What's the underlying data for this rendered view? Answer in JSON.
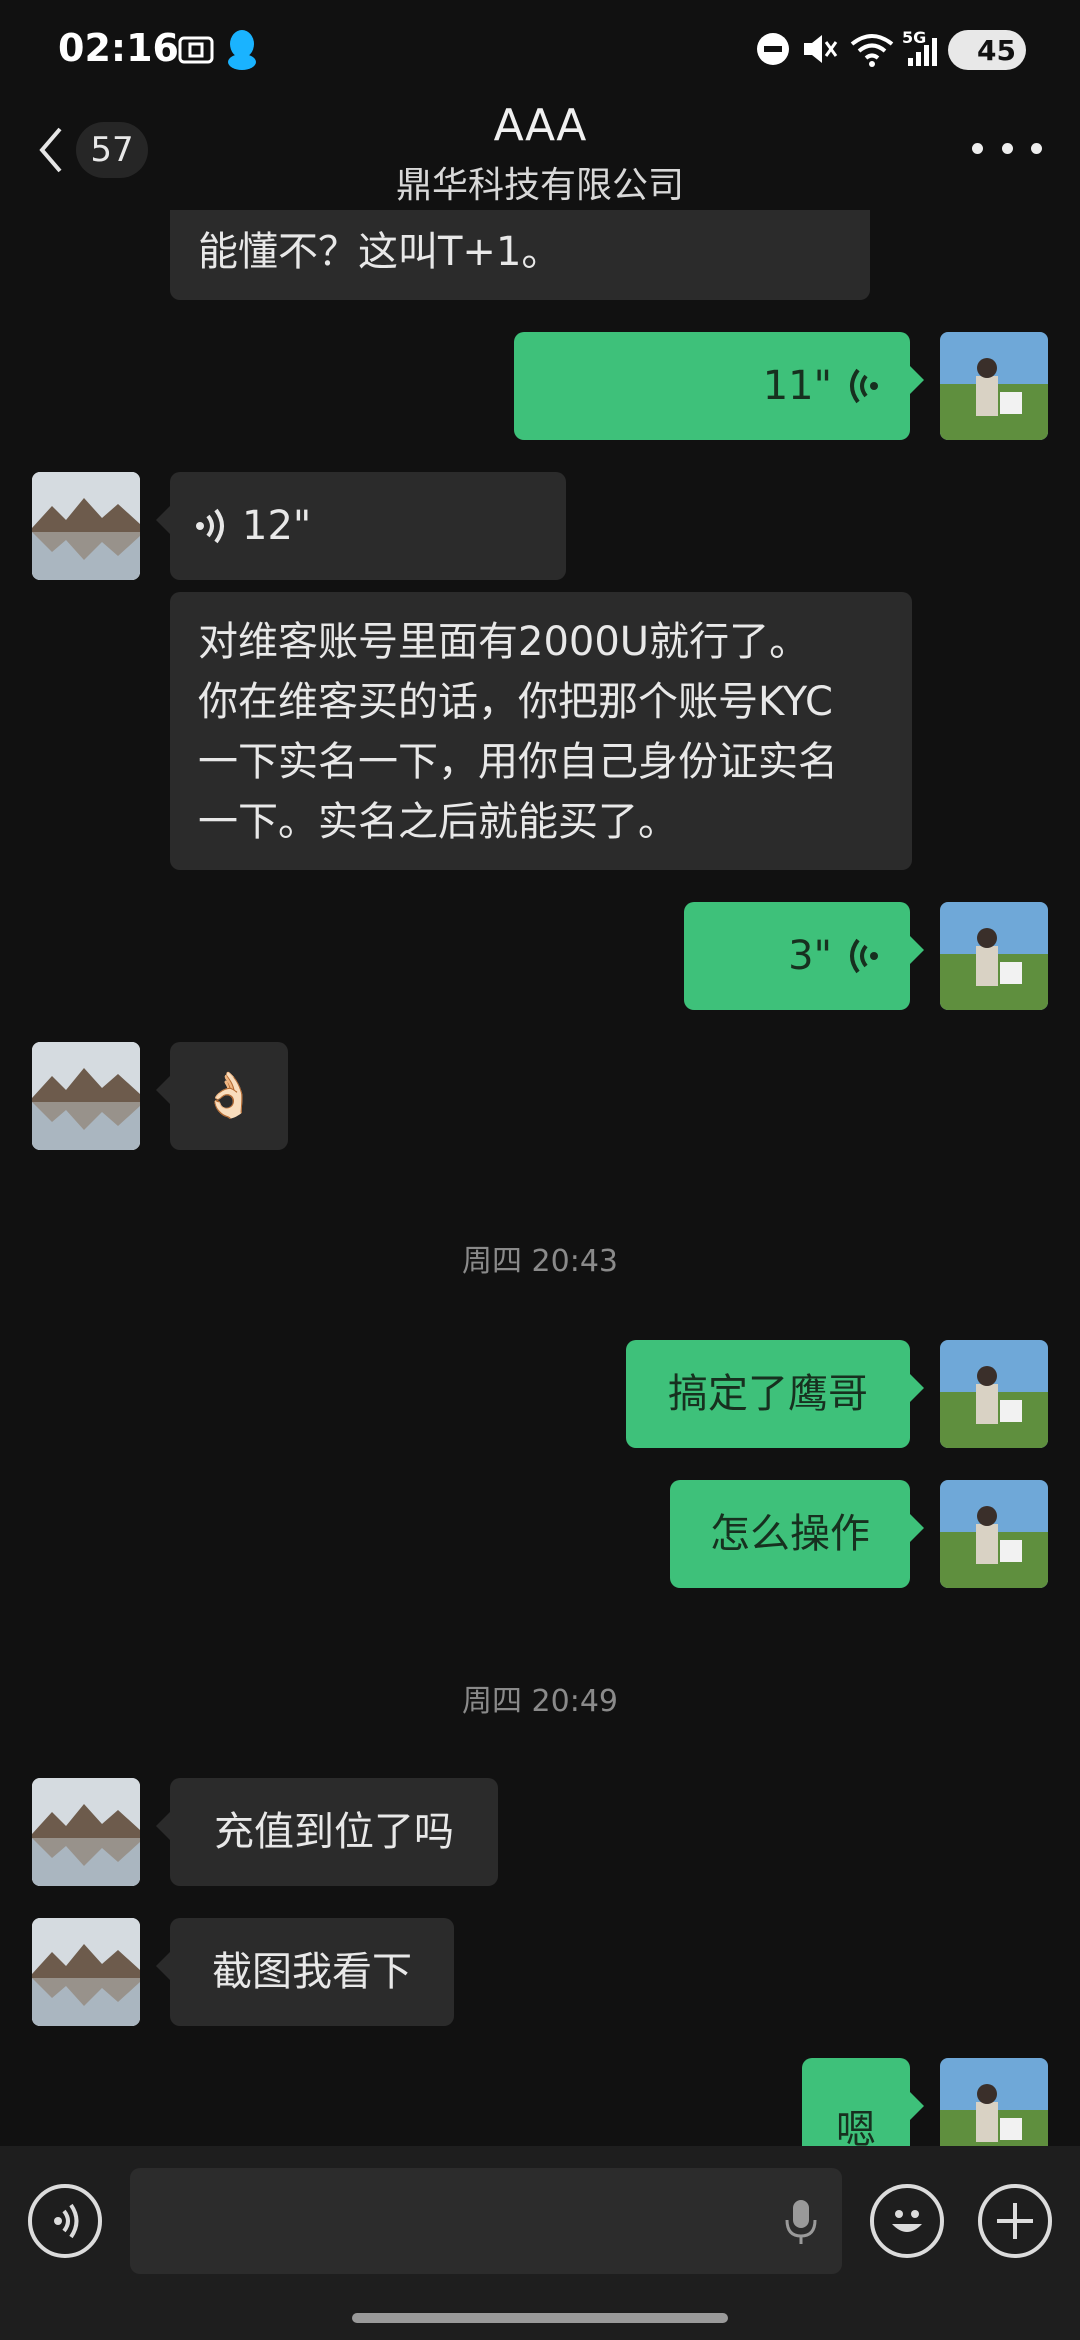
{
  "status_bar": {
    "time": "02:16",
    "network": "5G",
    "battery": "45",
    "icons": [
      "screenshot-icon",
      "qq-icon",
      "dnd-icon",
      "mute-icon",
      "wifi-icon",
      "signal-icon",
      "battery-icon"
    ]
  },
  "header": {
    "unread_count": "57",
    "title": "AAA",
    "subtitle": "鼎华科技有限公司"
  },
  "messages": [
    {
      "side": "in",
      "kind": "text",
      "text": "能懂不？这叫T+1。"
    },
    {
      "side": "out",
      "kind": "voice",
      "duration": "11\""
    },
    {
      "side": "in",
      "kind": "voice",
      "duration": "12\""
    },
    {
      "side": "in",
      "kind": "text",
      "lines": [
        "对维客账号里面有2000U就行了。",
        "你在维客买的话，你把那个账号KYC",
        "一下实名一下，用你自己身份证实名",
        "一下。实名之后就能买了。"
      ]
    },
    {
      "side": "out",
      "kind": "voice",
      "duration": "3\""
    },
    {
      "side": "in",
      "kind": "emoji",
      "text": "👌🏻"
    },
    {
      "side": "out",
      "kind": "text",
      "text": "搞定了鹰哥"
    },
    {
      "side": "out",
      "kind": "text",
      "text": "怎么操作"
    },
    {
      "side": "in",
      "kind": "text",
      "text": "充值到位了吗"
    },
    {
      "side": "in",
      "kind": "text",
      "text": "截图我看下"
    },
    {
      "side": "out",
      "kind": "text",
      "text": "嗯"
    }
  ],
  "timestamps": [
    "周四 20:43",
    "周四 20:49"
  ],
  "colors": {
    "background": "#111111",
    "incoming_bubble": "#2b2b2b",
    "outgoing_bubble": "#3ec17a",
    "timestamp": "#8a8a8a"
  }
}
